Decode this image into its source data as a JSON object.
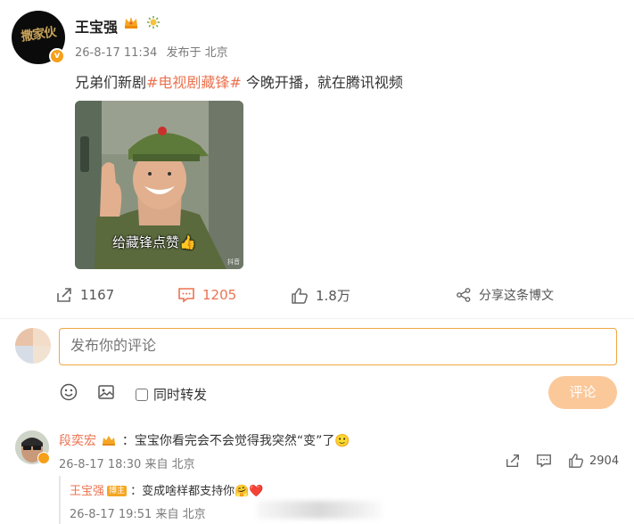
{
  "post": {
    "author": "王宝强",
    "avatar_logo": "撒家伙",
    "time": "26-8-17 11:34",
    "source": "发布于 北京",
    "text_before": "兄弟们新剧",
    "hashtag": "#电视剧藏锋#",
    "text_after": " 今晚开播，就在腾讯视频",
    "image_caption": "给藏锋点赞👍",
    "image_watermark": "抖音"
  },
  "actions": {
    "repost_count": "1167",
    "comment_count": "1205",
    "like_count": "1.8万",
    "share_label": "分享这条博文"
  },
  "composer": {
    "placeholder": "发布你的评论",
    "repost_label": "同时转发",
    "submit_label": "评论"
  },
  "comments": [
    {
      "author": "段奕宏",
      "text": "：宝宝你看完会不会觉得我突然“变”了🙂",
      "time": "26-8-17 18:30 来自 北京",
      "like_count": "2904",
      "reply": {
        "author": "王宝强",
        "badge": "博主",
        "text": "：变成啥样都支持你🤗❤️",
        "time": "26-8-17 19:51 来自 北京"
      }
    }
  ],
  "colors": {
    "accent": "#eb7350",
    "input_border": "#f0a541",
    "button_disabled": "#fbc89a",
    "verified": "#f6a01a"
  },
  "icons": [
    "crown-icon",
    "sun-icon",
    "repost-icon",
    "comment-icon",
    "like-icon",
    "share-icon",
    "emoji-icon",
    "image-icon"
  ]
}
